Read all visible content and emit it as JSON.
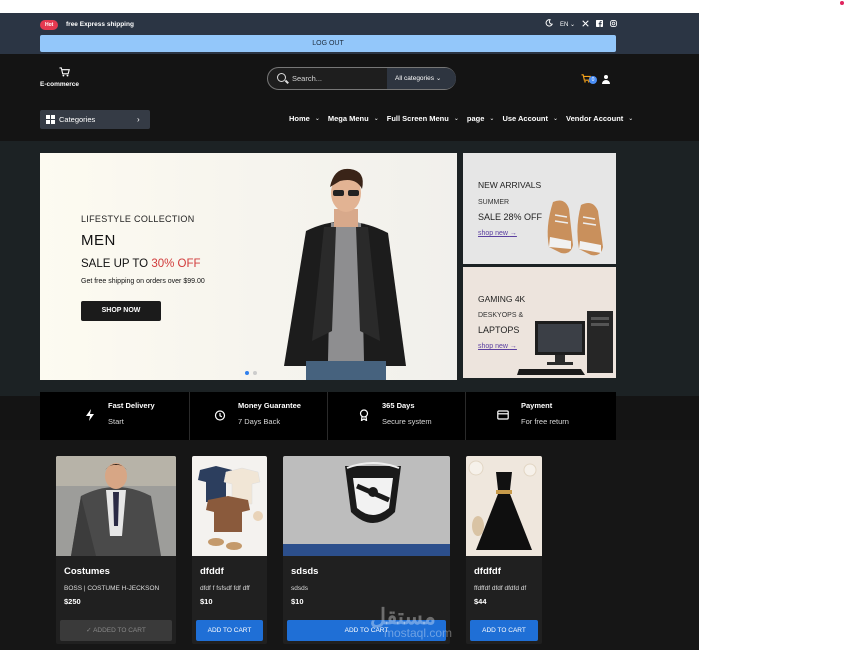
{
  "topbar": {
    "badge": "Hot",
    "promo": "free Express shipping",
    "lang": "EN",
    "logout": "LOG OUT"
  },
  "header": {
    "logo_name": "E-commerce",
    "search_placeholder": "Search...",
    "category_select": "All categories",
    "cart_count": "0"
  },
  "nav": {
    "categories_label": "Categories",
    "links": [
      "Home",
      "Mega Menu",
      "Full Screen Menu",
      "page",
      "Use Account",
      "Vendor Account"
    ]
  },
  "hero": {
    "kicker": "LIFESTYLE COLLECTION",
    "title": "MEN",
    "sale_prefix": "SALE UP TO ",
    "sale_pct": "30% OFF",
    "shipping": "Get free shipping on orders over $99.00",
    "cta": "SHOP NOW",
    "slides": 2,
    "active_slide": 1
  },
  "promos": [
    {
      "t1": "NEW ARRIVALS",
      "t2": "SUMMER",
      "t3": "SALE 28% OFF",
      "link": "shop new"
    },
    {
      "t1": "GAMING 4K",
      "t2": "DESKYOPS &",
      "t3": "LAPTOPS",
      "link": "shop new"
    }
  ],
  "features": [
    {
      "title": "Fast Delivery",
      "sub": "Start",
      "icon": "bolt-icon"
    },
    {
      "title": "Money Guarantee",
      "sub": "7 Days Back",
      "icon": "clock-icon"
    },
    {
      "title": "365 Days",
      "sub": "Secure system",
      "icon": "award-icon"
    },
    {
      "title": "Payment",
      "sub": "For free return",
      "icon": "card-icon"
    }
  ],
  "products": [
    {
      "name": "Costumes",
      "desc": "BOSS | COSTUME H-JECKSON",
      "price": "$250",
      "cta": "ADDED TO CART",
      "added": true
    },
    {
      "name": "dfddf",
      "desc": "dfdf f fsfsdf fdf dff",
      "price": "$10",
      "cta": "ADD TO CART",
      "added": false
    },
    {
      "name": "sdsds",
      "desc": "sdsds",
      "price": "$10",
      "cta": "ADD TO CART",
      "added": false
    },
    {
      "name": "dfdfdf",
      "desc": "ffdffdf dfdf dfdfd df",
      "price": "$44",
      "cta": "ADD TO CART",
      "added": false
    }
  ],
  "watermark": {
    "arabic": "مستقل",
    "latin": "mostaql.com"
  },
  "colors": {
    "accent": "#1f6fd6",
    "sale": "#d13a3a",
    "logout_bar": "#93c7fa",
    "hot": "#e53950",
    "cart": "#f6a21a"
  }
}
